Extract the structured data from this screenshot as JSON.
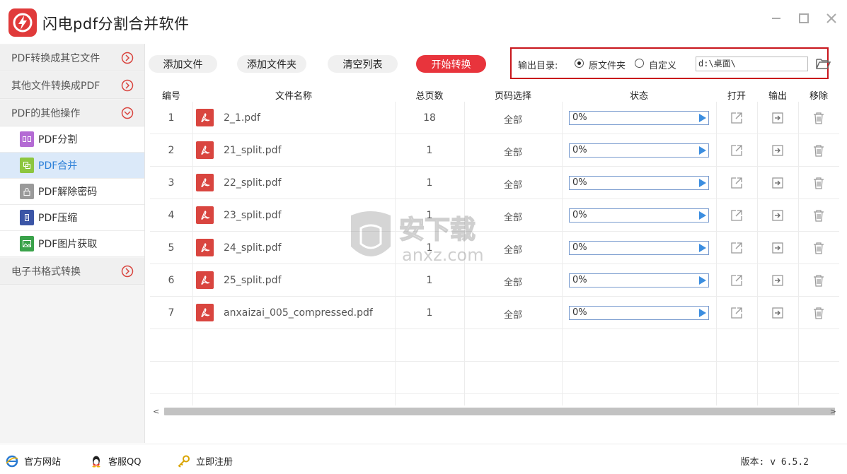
{
  "app": {
    "title": "闪电pdf分割合并软件",
    "accent_color": "#e8343c",
    "logo_icon": "lightning-icon"
  },
  "window_controls": [
    "minimize-icon",
    "maximize-icon",
    "close-icon"
  ],
  "sidebar": {
    "groups": [
      {
        "label": "PDF转换成其它文件",
        "icon": "chevron-right-circle-icon"
      },
      {
        "label": "其他文件转换成PDF",
        "icon": "chevron-right-circle-icon"
      },
      {
        "label": "PDF的其他操作",
        "icon": "chevron-down-circle-icon"
      },
      {
        "label": "电子书格式转换",
        "icon": "chevron-right-circle-icon"
      }
    ],
    "sub_items": [
      {
        "label": "PDF分割",
        "icon": "split-file-icon",
        "color": "#b46bd4"
      },
      {
        "label": "PDF合并",
        "icon": "merge-file-icon",
        "color": "#8dc63f",
        "active": true
      },
      {
        "label": "PDF解除密码",
        "icon": "lock-file-icon",
        "color": "#9a9a9a"
      },
      {
        "label": "PDF压缩",
        "icon": "compress-file-icon",
        "color": "#3b55a6"
      },
      {
        "label": "PDF图片获取",
        "icon": "image-file-icon",
        "color": "#3aa24a"
      }
    ]
  },
  "toolbar": {
    "add_file": "添加文件",
    "add_folder": "添加文件夹",
    "clear_list": "清空列表",
    "start": "开始转换"
  },
  "output": {
    "label": "输出目录:",
    "option_original": "原文件夹",
    "option_custom": "自定义",
    "selected": "原文件夹",
    "path": "d:\\桌面\\"
  },
  "table": {
    "headers": [
      "编号",
      "文件名称",
      "总页数",
      "页码选择",
      "状态",
      "打开",
      "输出",
      "移除"
    ],
    "rows": [
      {
        "num": "1",
        "name": "2_1.pdf",
        "pages": "18",
        "range": "全部",
        "status": "0%"
      },
      {
        "num": "2",
        "name": "21_split.pdf",
        "pages": "1",
        "range": "全部",
        "status": "0%"
      },
      {
        "num": "3",
        "name": "22_split.pdf",
        "pages": "1",
        "range": "全部",
        "status": "0%"
      },
      {
        "num": "4",
        "name": "23_split.pdf",
        "pages": "1",
        "range": "全部",
        "status": "0%"
      },
      {
        "num": "5",
        "name": "24_split.pdf",
        "pages": "1",
        "range": "全部",
        "status": "0%"
      },
      {
        "num": "6",
        "name": "25_split.pdf",
        "pages": "1",
        "range": "全部",
        "status": "0%"
      },
      {
        "num": "7",
        "name": "anxaizai_005_compressed.pdf",
        "pages": "1",
        "range": "全部",
        "status": "0%"
      }
    ]
  },
  "watermark": {
    "text_cn": "安下载",
    "text_en": "anxz.com"
  },
  "footer": {
    "website": "官方网站",
    "support": "客服QQ",
    "register": "立即注册",
    "version": "版本: v 6.5.2"
  }
}
